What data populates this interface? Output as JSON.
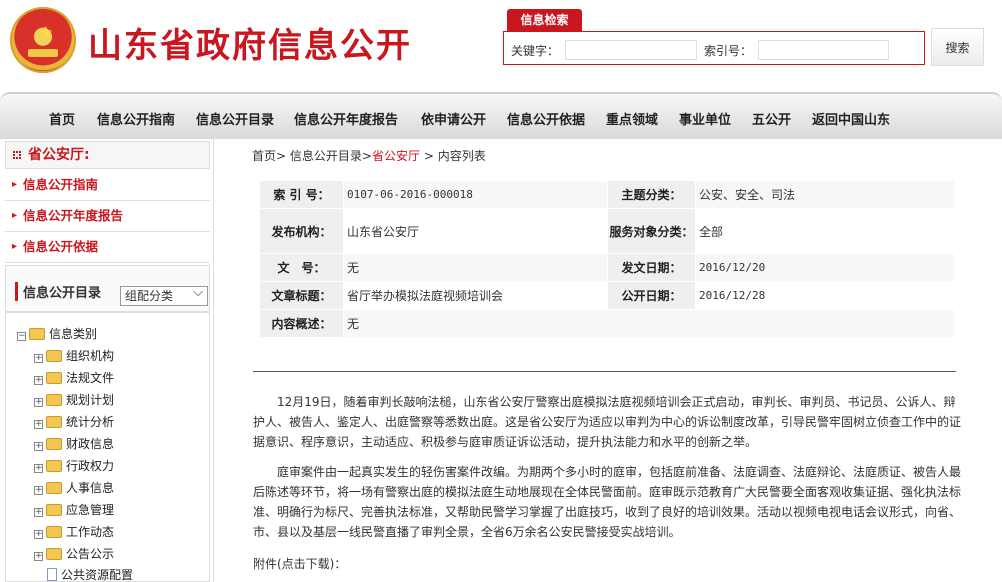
{
  "header": {
    "site_title": "山东省政府信息公开",
    "search_tab": "信息检索",
    "keyword_label": "关键字：",
    "index_label": "索引号：",
    "search_button": "搜索",
    "keyword_value": "",
    "index_value": ""
  },
  "nav": {
    "items": [
      "首页",
      "信息公开指南",
      "信息公开目录",
      "信息公开年度报告",
      "依申请公开",
      "信息公开依据",
      "重点领域",
      "事业单位",
      "五公开",
      "返回中国山东"
    ]
  },
  "sidebar": {
    "org_title": "省公安厅:",
    "links": [
      "信息公开指南",
      "信息公开年度报告",
      "信息公开依据"
    ],
    "catalog_title": "信息公开目录",
    "catalog_select_value": "组配分类",
    "tree_root": "信息类别",
    "tree_items": [
      "组织机构",
      "法规文件",
      "规划计划",
      "统计分析",
      "财政信息",
      "行政权力",
      "人事信息",
      "应急管理",
      "工作动态",
      "公告公示",
      "公共资源配置"
    ]
  },
  "breadcrumb": {
    "home": "首页",
    "sep1": ">",
    "catalog": "信息公开目录",
    "sep2": ">",
    "current": "省公安厅",
    "sep3": ">",
    "tail": "内容列表"
  },
  "meta": {
    "index_label": "索 引 号：",
    "index_value": "0107-06-2016-000018",
    "theme_label": "主题分类：",
    "theme_value": "公安、安全、司法",
    "publisher_label": "发布机构：",
    "publisher_value": "山东省公安厅",
    "service_label": "服务对象分类：",
    "service_value": "全部",
    "doc_no_label": "文　号：",
    "doc_no_value": "无",
    "issue_date_label": "发文日期：",
    "issue_date_value": "2016/12/20",
    "title_label": "文章标题：",
    "title_value": "省厅举办模拟法庭视频培训会",
    "public_date_label": "公开日期：",
    "public_date_value": "2016/12/28",
    "summary_label": "内容概述：",
    "summary_value": "无"
  },
  "article": {
    "paragraphs": [
      "12月19日，随着审判长敲响法槌，山东省公安厅警察出庭模拟法庭视频培训会正式启动，审判长、审判员、书记员、公诉人、辩护人、被告人、鉴定人、出庭警察等悉数出庭。这是省公安厅为适应以审判为中心的诉讼制度改革，引导民警牢固树立侦查工作中的证据意识、程序意识，主动适应、积极参与庭审质证诉讼活动，提升执法能力和水平的创新之举。",
      "庭审案件由一起真实发生的轻伤害案件改编。为期两个多小时的庭审，包括庭前准备、法庭调查、法庭辩论、法庭质证、被告人最后陈述等环节，将一场有警察出庭的模拟法庭生动地展现在全体民警面前。庭审既示范教育广大民警要全面客观收集证据、强化执法标准、明确行为标尺、完善执法标准，又帮助民警学习掌握了出庭技巧，收到了良好的培训效果。活动以视频电视电话会议形式，向省、市、县以及基层一线民警直播了审判全景，全省6万余名公安民警接受实战培训。"
    ],
    "attachment": "附件(点击下载)："
  },
  "colors": {
    "accent": "#c8171f"
  }
}
